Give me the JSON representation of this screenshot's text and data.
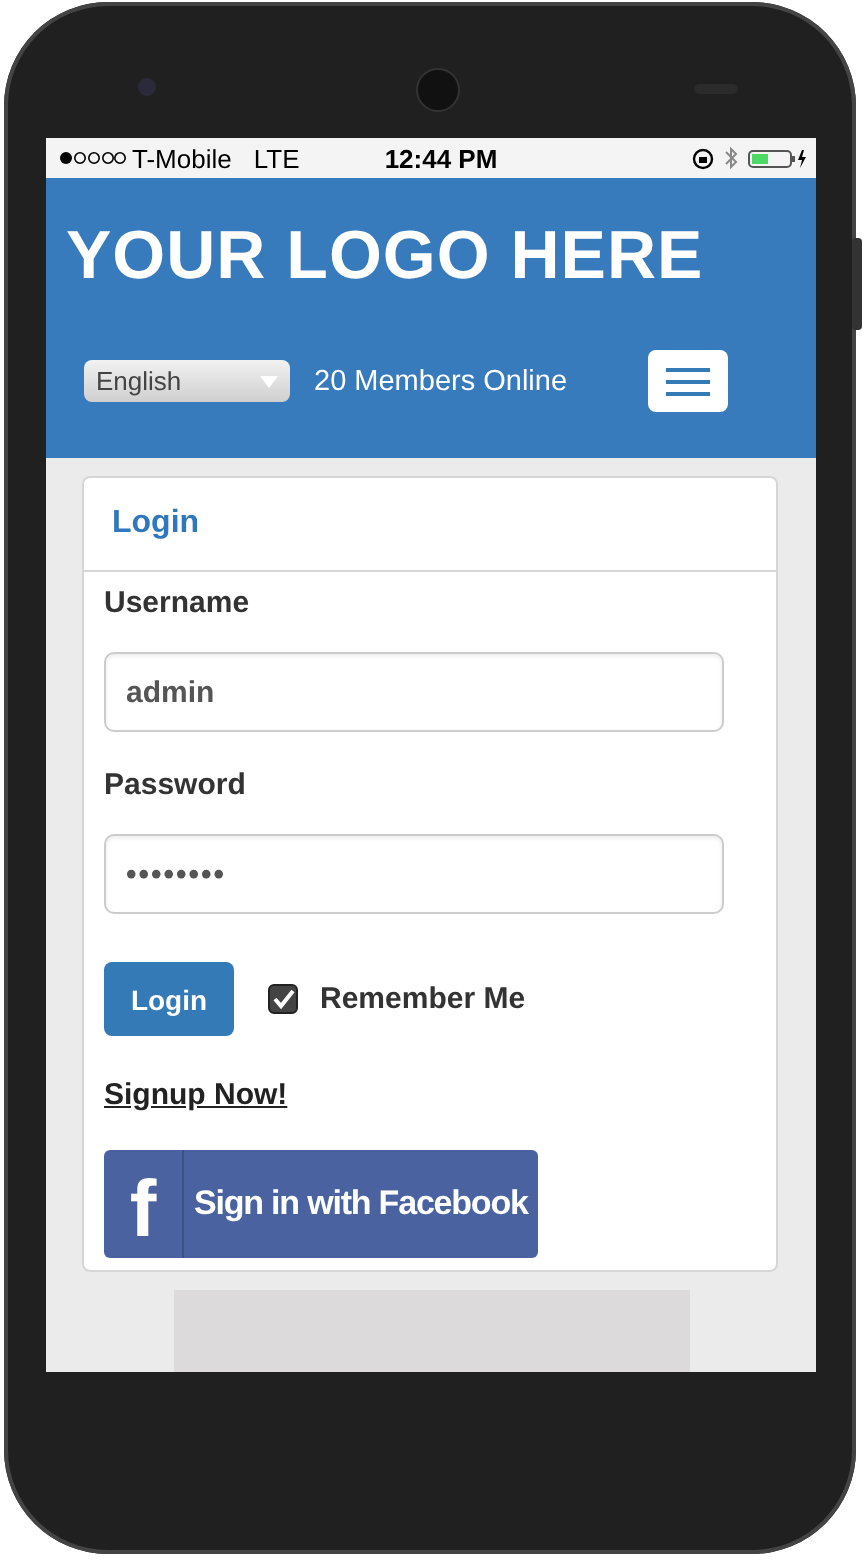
{
  "status_bar": {
    "carrier": "T-Mobile",
    "network": "LTE",
    "time": "12:44 PM"
  },
  "header": {
    "logo": "YOUR LOGO HERE",
    "language": "English",
    "members_online": "20 Members Online"
  },
  "login": {
    "title": "Login",
    "fields": [
      {
        "label": "Username",
        "value": "admin",
        "kind": "text"
      },
      {
        "label": "Password",
        "value": "••••••••",
        "kind": "password"
      }
    ],
    "button": "Login",
    "remember": {
      "label": "Remember Me",
      "checked": true
    },
    "signup_link": "Signup Now!",
    "facebook": {
      "icon": "f",
      "label": "Sign in with Facebook"
    }
  }
}
